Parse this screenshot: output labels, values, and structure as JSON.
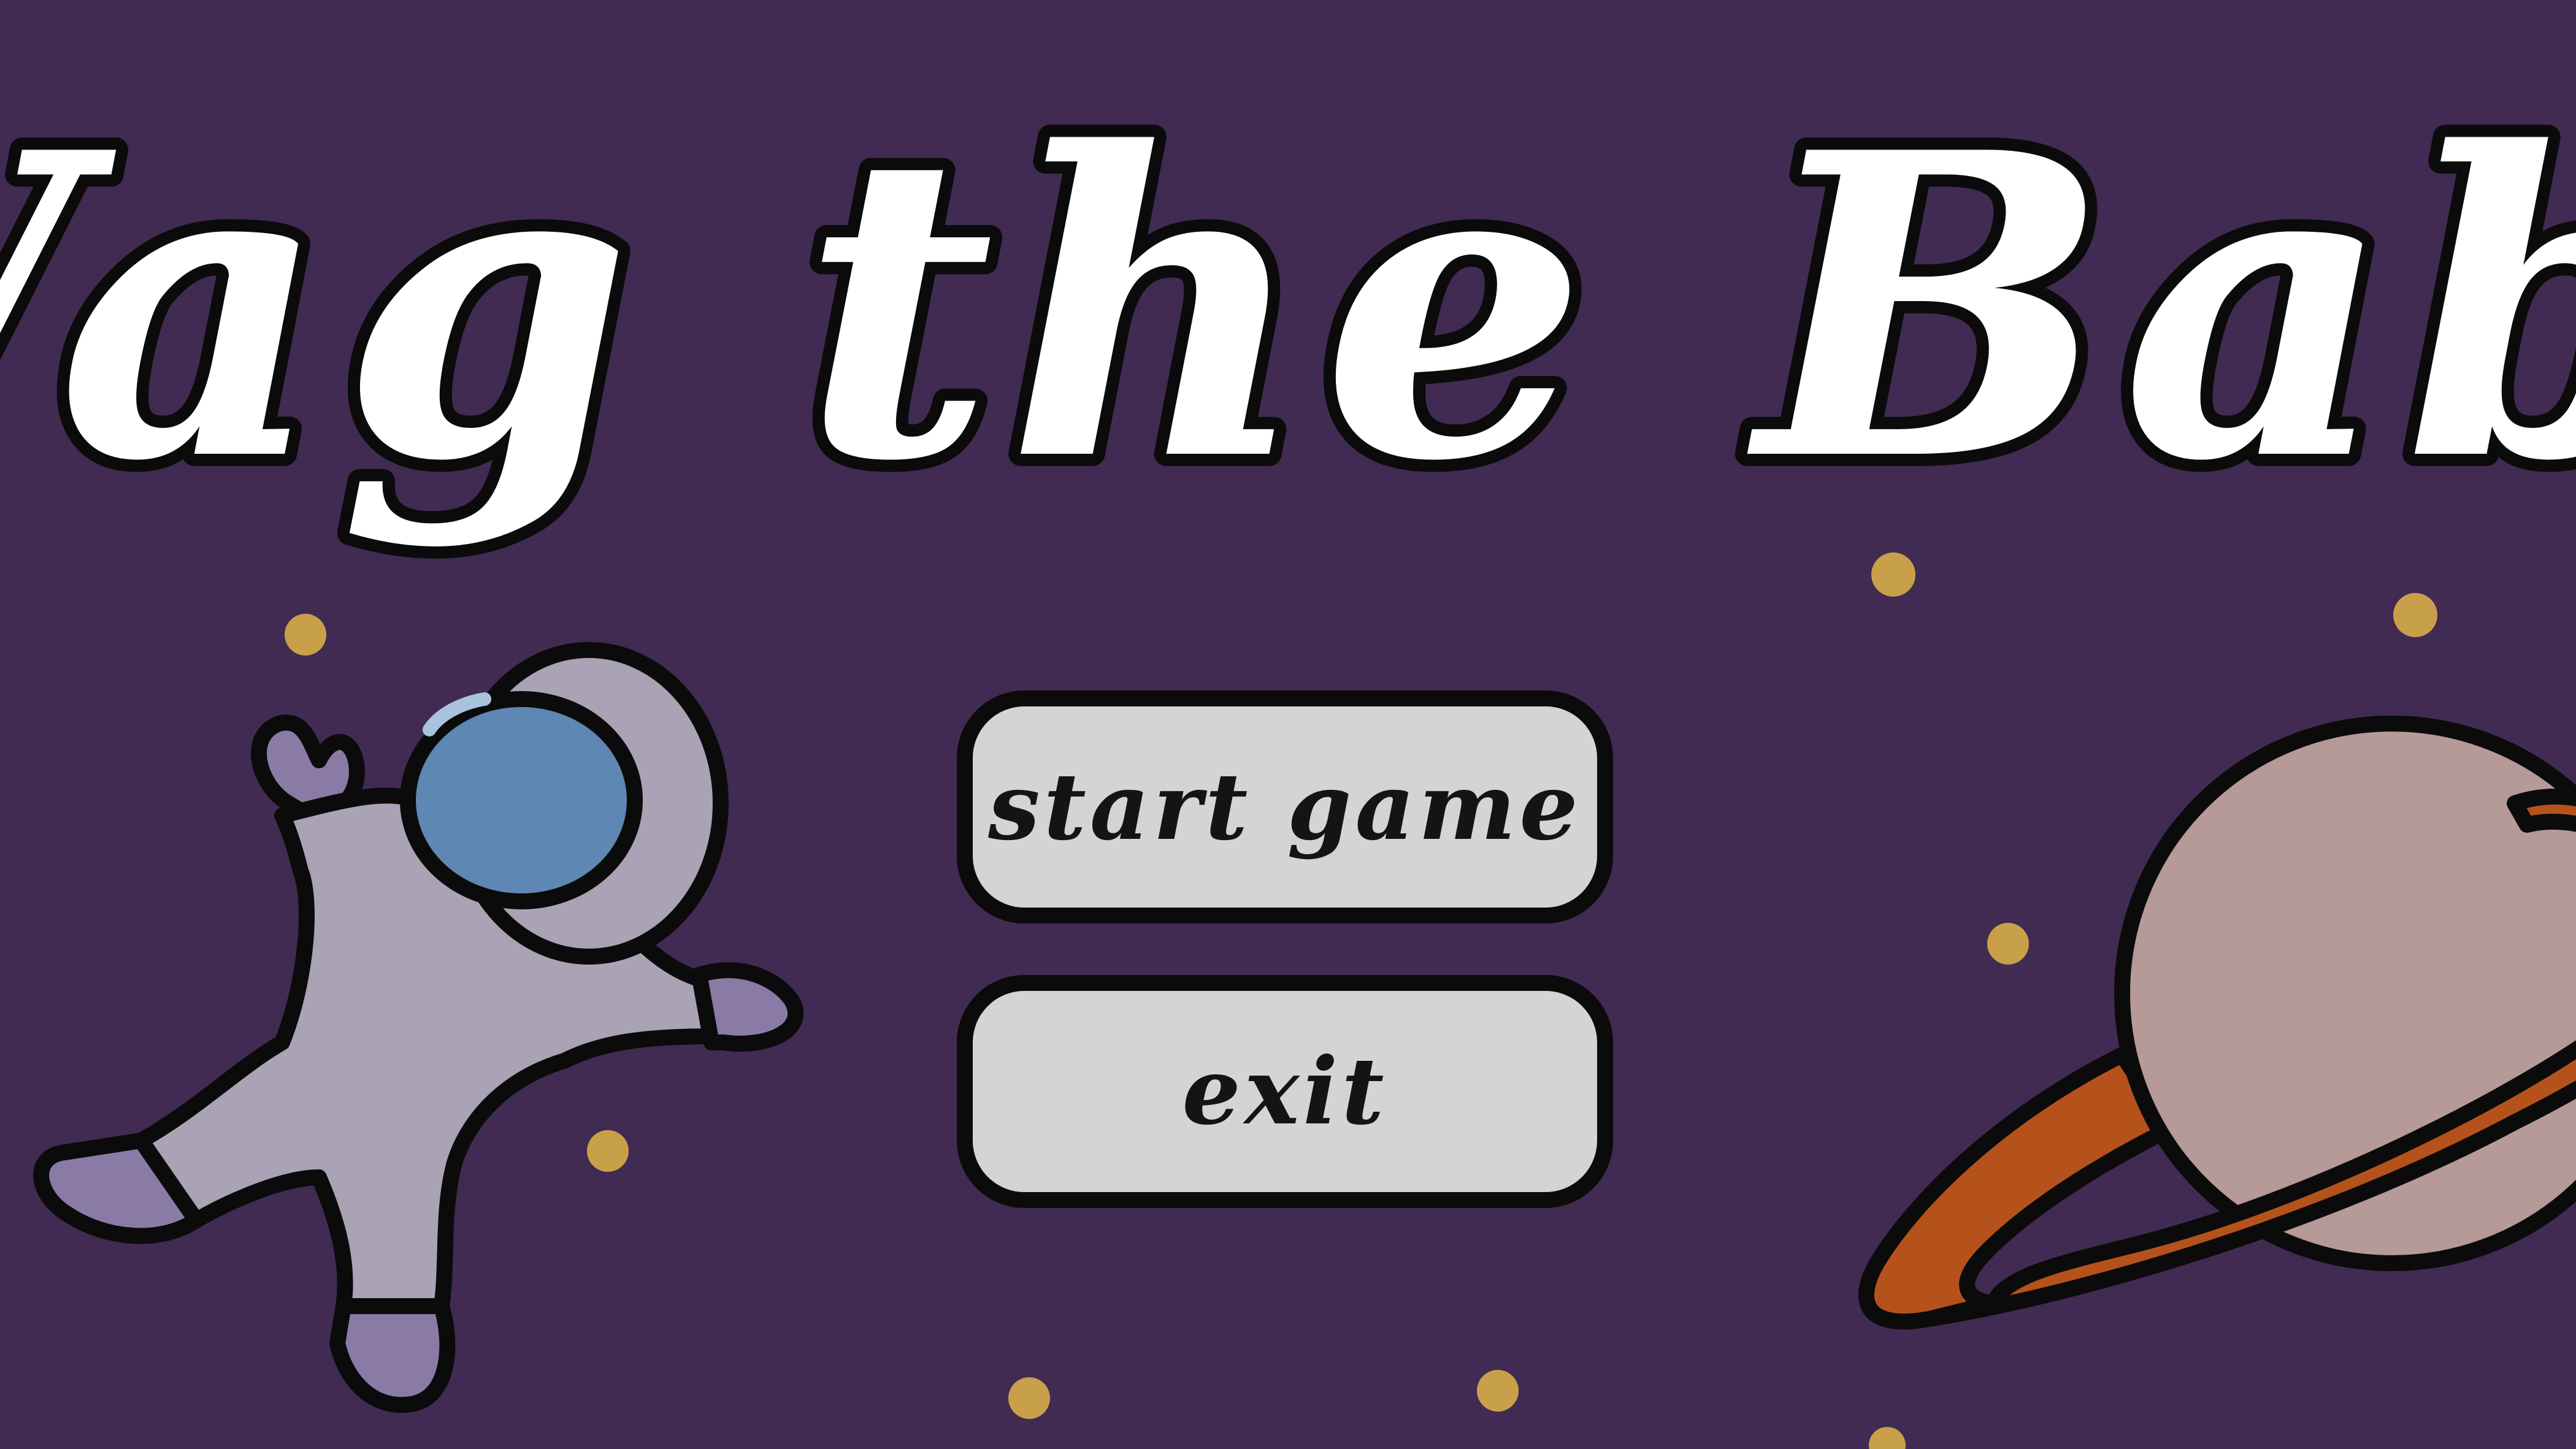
{
  "game": {
    "title": "Wag the Baby"
  },
  "menu": {
    "start_label": "start game",
    "exit_label": "exit"
  },
  "colors": {
    "background": "#412b52",
    "button_fill": "#d4d4d6",
    "outline": "#0b0b0b",
    "star": "#c9a04a",
    "astronaut_suit": "#aaa2b5",
    "astronaut_glove": "#8a7aa6",
    "helmet_visor": "#5e87b3",
    "planet_body": "#b69a98",
    "planet_ring": "#b5521b"
  },
  "icons": [
    "astronaut-icon",
    "planet-icon",
    "star-icon"
  ]
}
